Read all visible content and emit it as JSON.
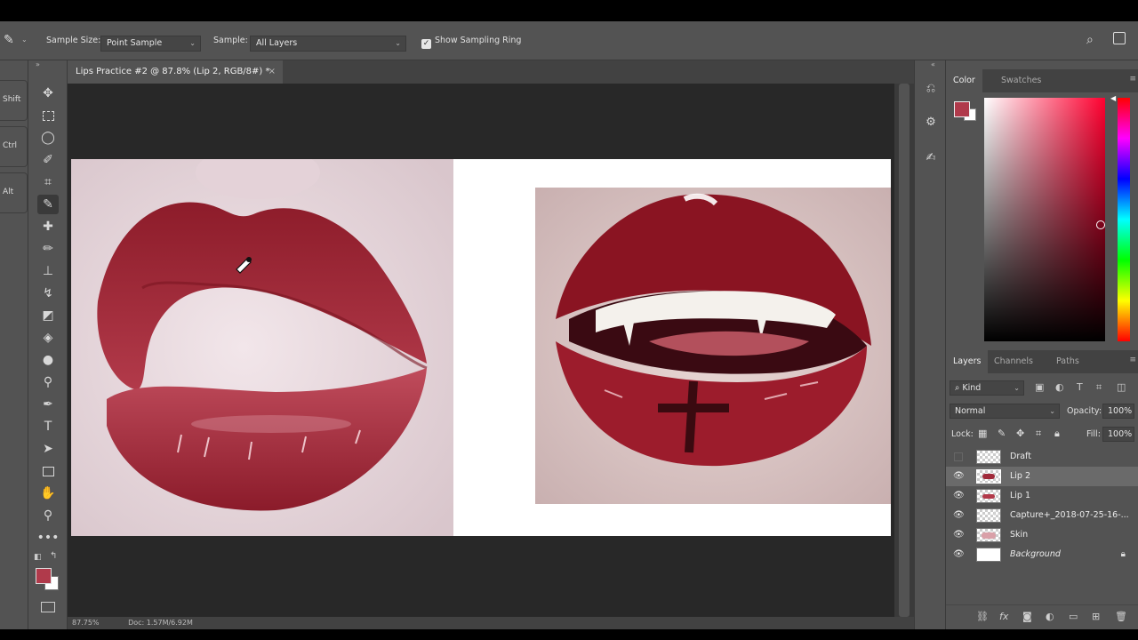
{
  "options_bar": {
    "sample_size_label": "Sample Size:",
    "sample_size_value": "Point Sample",
    "sample_label": "Sample:",
    "sample_value": "All Layers",
    "show_sampling_ring_label": "Show Sampling Ring",
    "show_sampling_ring_checked": true
  },
  "modifiers": [
    "Shift",
    "Ctrl",
    "Alt"
  ],
  "document": {
    "tab_title": "Lips Practice #2 @ 87.8% (Lip 2, RGB/8#) *",
    "close_glyph": "×",
    "status_zoom": "87.75%",
    "status_doc": "Doc: 1.57M/6.92M"
  },
  "color_panel": {
    "tabs": [
      "Color",
      "Swatches"
    ],
    "foreground": "#b03a4b",
    "background": "#ffffff"
  },
  "layers_panel": {
    "tabs": [
      "Layers",
      "Channels",
      "Paths"
    ],
    "filter_kind": "Kind",
    "blend_mode": "Normal",
    "opacity_label": "Opacity:",
    "opacity_value": "100%",
    "lock_label": "Lock:",
    "fill_label": "Fill:",
    "fill_value": "100%",
    "layers": [
      {
        "name": "Draft",
        "visible": false,
        "selected": false
      },
      {
        "name": "Lip 2",
        "visible": true,
        "selected": true
      },
      {
        "name": "Lip 1",
        "visible": true,
        "selected": false
      },
      {
        "name": "Capture+_2018-07-25-16-...",
        "visible": true,
        "selected": false
      },
      {
        "name": "Skin",
        "visible": true,
        "selected": false
      },
      {
        "name": "Background",
        "visible": true,
        "selected": false,
        "locked": true
      }
    ]
  },
  "accent": "#535353"
}
